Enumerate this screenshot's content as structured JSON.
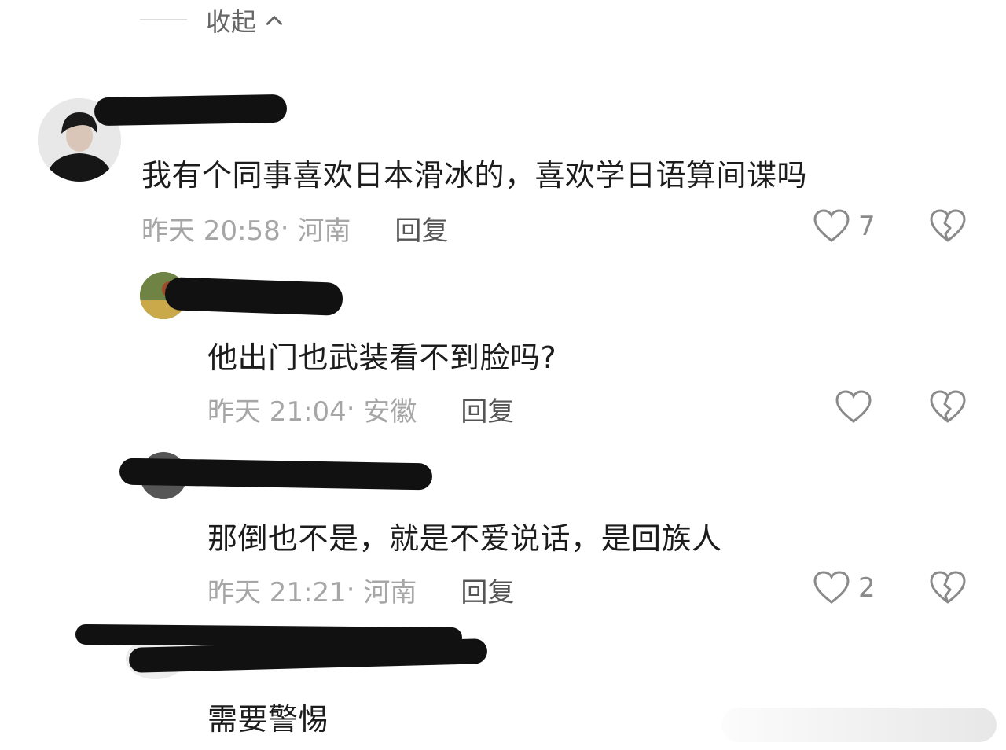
{
  "collapse": {
    "label": "收起",
    "icon": "chevron-up-icon"
  },
  "comments": [
    {
      "text": "我有个同事喜欢日本滑冰的，喜欢学日语算间谍吗",
      "time": "昨天 20:58",
      "location": "河南",
      "reply_label": "回复",
      "likes": "7"
    },
    {
      "text": "他出门也武装看不到脸吗?",
      "time": "昨天 21:04",
      "location": "安徽",
      "reply_label": "回复",
      "likes": ""
    },
    {
      "text": "那倒也不是，就是不爱说话，是回族人",
      "time": "昨天 21:21",
      "location": "河南",
      "reply_label": "回复",
      "likes": "2"
    },
    {
      "text": "需要警惕"
    }
  ],
  "colors": {
    "text": "#1c1c1c",
    "meta": "#a6a6a6",
    "icon": "#8a8a8a",
    "redaction": "#111111"
  }
}
